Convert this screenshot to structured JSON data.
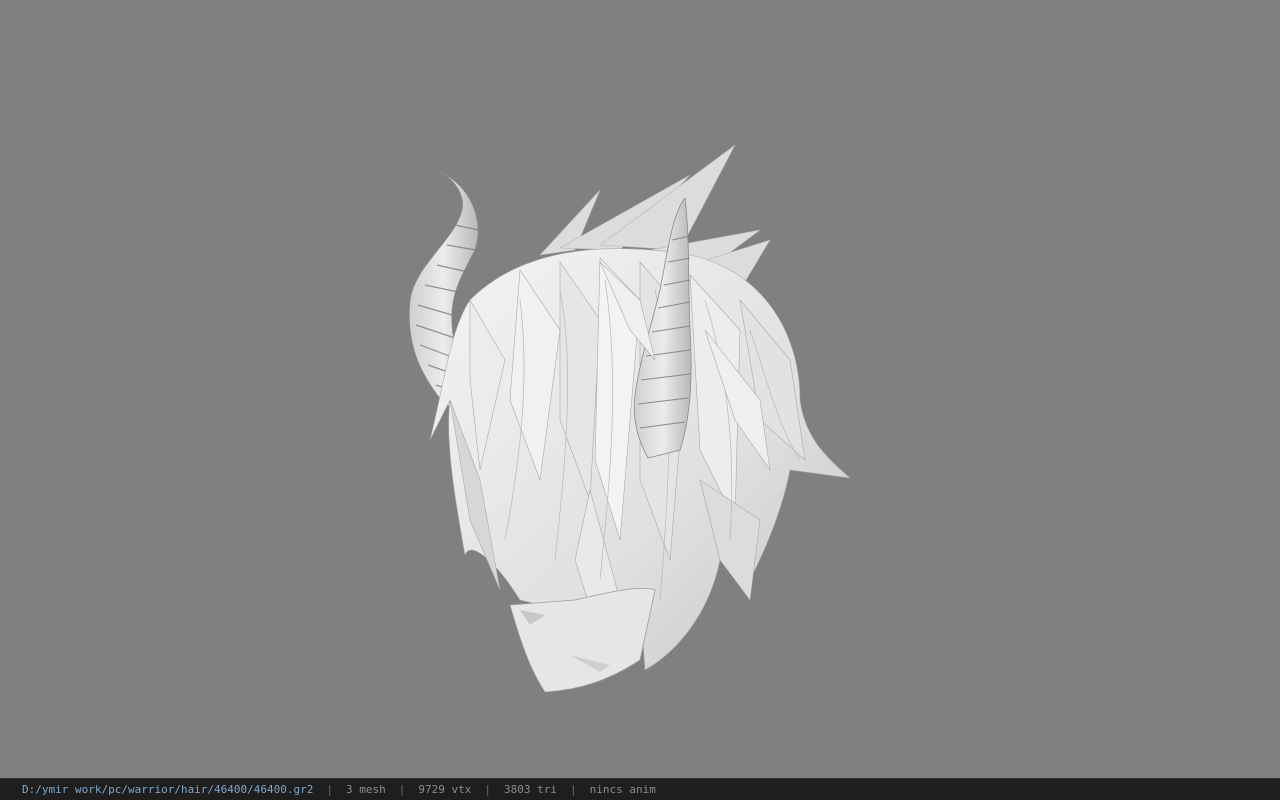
{
  "viewer": {
    "background_color": "#808080",
    "model_color": "#e8e8e8",
    "model_icon": "horned-hair-model"
  },
  "status_bar": {
    "file_path": "D:/ymir work/pc/warrior/hair/46400/46400.gr2",
    "separator": "|",
    "mesh_count": "3 mesh",
    "vertex_count": "9729 vtx",
    "triangle_count": "3803 tri",
    "animation": "nincs anim"
  }
}
